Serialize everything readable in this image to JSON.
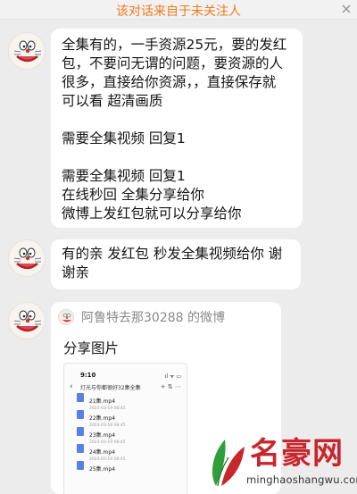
{
  "banner": {
    "text": "该对话来自于未关注人"
  },
  "messages": [
    {
      "lines": [
        "全集有的，一手资源25元，要的发红",
        "包，不要问无谓的问题，要资源的人",
        "很多，直接给你资源，，直接保存就",
        "可以看 超清画质",
        "",
        "需要全集视频 回复1",
        "",
        "需要全集视频 回复1",
        "在线秒回 全集分享给你",
        "微博上发红包就可以分享给你"
      ]
    },
    {
      "lines": [
        "有的亲  发红包 秒发全集视频给你 谢",
        "谢亲"
      ]
    }
  ],
  "share_card": {
    "title": "阿鲁特去那30288 的微博",
    "label": "分享图片",
    "screenshot": {
      "time": "9:10",
      "status": "ıl ᯤ ▭",
      "title": "灯光与你都很好32集全集",
      "tools": "+ ⇅ ⋯",
      "files": [
        {
          "name": "21集.mp4",
          "meta": "2023-03-19 08:45"
        },
        {
          "name": "22集.mp4",
          "meta": "2023-03-19 08:45"
        },
        {
          "name": "23集.mp4",
          "meta": "2023-03-19 08:45"
        },
        {
          "name": "24集.mp4",
          "meta": "2023-03-19 08:45"
        },
        {
          "name": "25集.mp4",
          "meta": ""
        }
      ]
    }
  },
  "watermark": {
    "brand_cn": "名豪网",
    "brand_url": "minghaoshangwu.com"
  },
  "colors": {
    "background": "#ececec",
    "bubble": "#ffffff",
    "banner_text": "#f07a1a",
    "watermark_red": "#c8262c",
    "file_icon": "#5a7fe6"
  }
}
